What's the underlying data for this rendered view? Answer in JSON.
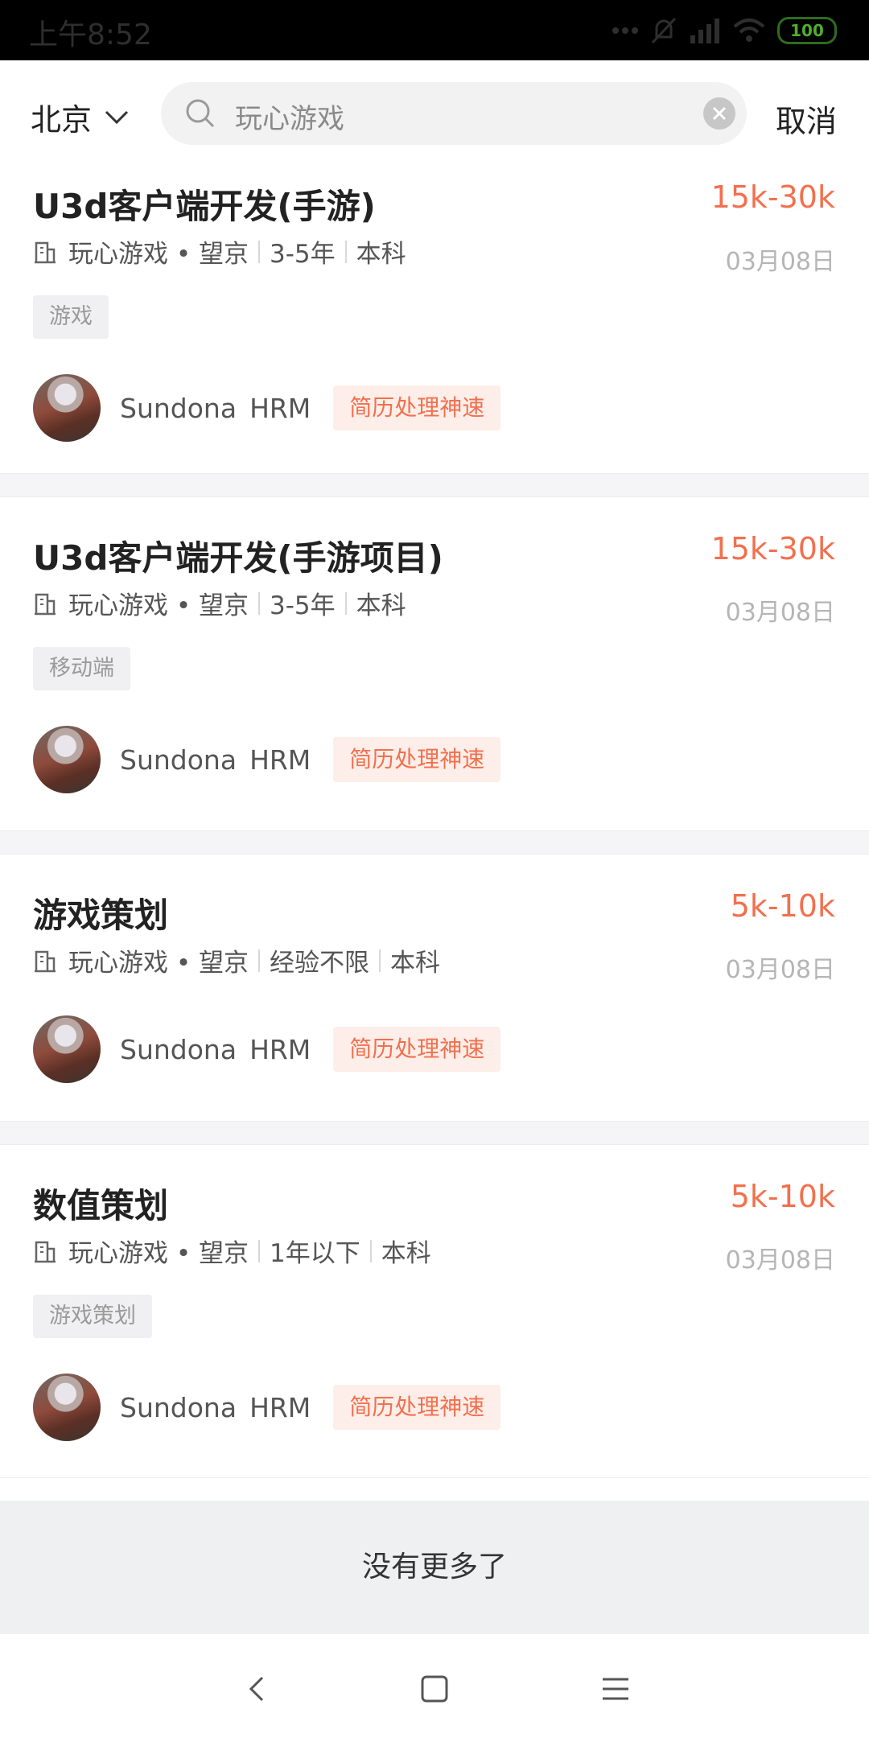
{
  "status_bar": {
    "time": "上午8:52",
    "battery": "100"
  },
  "header": {
    "city": "北京",
    "search_value": "玩心游戏",
    "cancel_label": "取消"
  },
  "jobs": [
    {
      "title": "U3d客户端开发(手游)",
      "salary": "15k-30k",
      "company_location": "玩心游戏 • 望京",
      "experience": "3-5年",
      "education": "本科",
      "date": "03月08日",
      "tag": "游戏",
      "hr_name": "Sundona",
      "hr_title": "HRM",
      "badge": "简历处理神速"
    },
    {
      "title": "U3d客户端开发(手游项目)",
      "salary": "15k-30k",
      "company_location": "玩心游戏 • 望京",
      "experience": "3-5年",
      "education": "本科",
      "date": "03月08日",
      "tag": "移动端",
      "hr_name": "Sundona",
      "hr_title": "HRM",
      "badge": "简历处理神速"
    },
    {
      "title": "游戏策划",
      "salary": "5k-10k",
      "company_location": "玩心游戏 • 望京",
      "experience": "经验不限",
      "education": "本科",
      "date": "03月08日",
      "hr_name": "Sundona",
      "hr_title": "HRM",
      "badge": "简历处理神速"
    },
    {
      "title": "数值策划",
      "salary": "5k-10k",
      "company_location": "玩心游戏 • 望京",
      "experience": "1年以下",
      "education": "本科",
      "date": "03月08日",
      "tag": "游戏策划",
      "hr_name": "Sundona",
      "hr_title": "HRM",
      "badge": "简历处理神速"
    }
  ],
  "footer": {
    "no_more": "没有更多了"
  },
  "colors": {
    "accent": "#f2704e",
    "badge_bg": "#fdeee9",
    "status_bar": "#000000"
  },
  "icons": [
    "chevron-down-icon",
    "search-icon",
    "clear-icon",
    "building-icon",
    "back-icon",
    "home-icon",
    "menu-icon"
  ]
}
